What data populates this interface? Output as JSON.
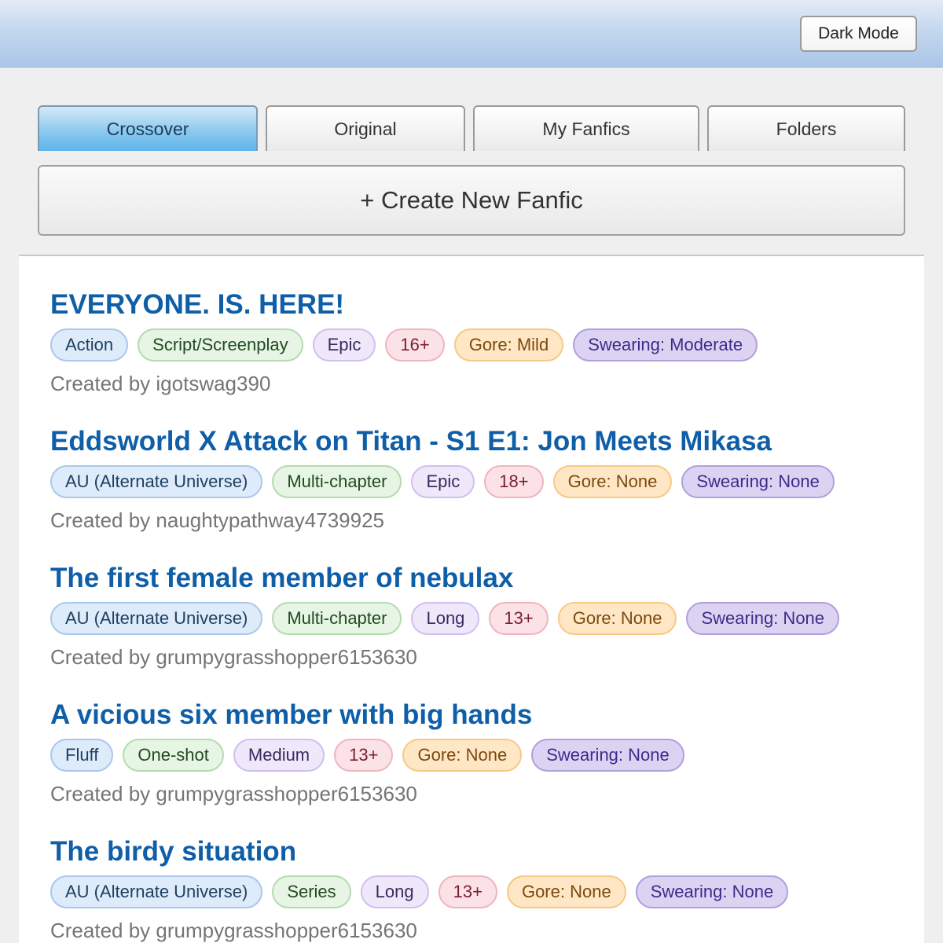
{
  "header": {
    "dark_mode_label": "Dark Mode"
  },
  "tabs": [
    {
      "label": "Crossover",
      "active": true
    },
    {
      "label": "Original",
      "active": false
    },
    {
      "label": "My Fanfics",
      "active": false
    },
    {
      "label": "Folders",
      "active": false
    }
  ],
  "create_button": {
    "label": "+ Create New Fanfic"
  },
  "fanfics": [
    {
      "title": "EVERYONE. IS. HERE!",
      "tags": {
        "genre": "Action",
        "format": "Script/Screenplay",
        "length": "Epic",
        "rating": "16+",
        "gore": "Gore: Mild",
        "swearing": "Swearing: Moderate"
      },
      "author": "Created by igotswag390"
    },
    {
      "title": "Eddsworld X Attack on Titan - S1 E1: Jon Meets Mikasa",
      "tags": {
        "genre": "AU (Alternate Universe)",
        "format": "Multi-chapter",
        "length": "Epic",
        "rating": "18+",
        "gore": "Gore: None",
        "swearing": "Swearing: None"
      },
      "author": "Created by naughtypathway4739925"
    },
    {
      "title": "The first female member of nebulax",
      "tags": {
        "genre": "AU (Alternate Universe)",
        "format": "Multi-chapter",
        "length": "Long",
        "rating": "13+",
        "gore": "Gore: None",
        "swearing": "Swearing: None"
      },
      "author": "Created by grumpygrasshopper6153630"
    },
    {
      "title": "A vicious six member with big hands",
      "tags": {
        "genre": "Fluff",
        "format": "One-shot",
        "length": "Medium",
        "rating": "13+",
        "gore": "Gore: None",
        "swearing": "Swearing: None"
      },
      "author": "Created by grumpygrasshopper6153630"
    },
    {
      "title": "The birdy situation",
      "tags": {
        "genre": "AU (Alternate Universe)",
        "format": "Series",
        "length": "Long",
        "rating": "13+",
        "gore": "Gore: None",
        "swearing": "Swearing: None"
      },
      "author": "Created by grumpygrasshopper6153630"
    }
  ]
}
